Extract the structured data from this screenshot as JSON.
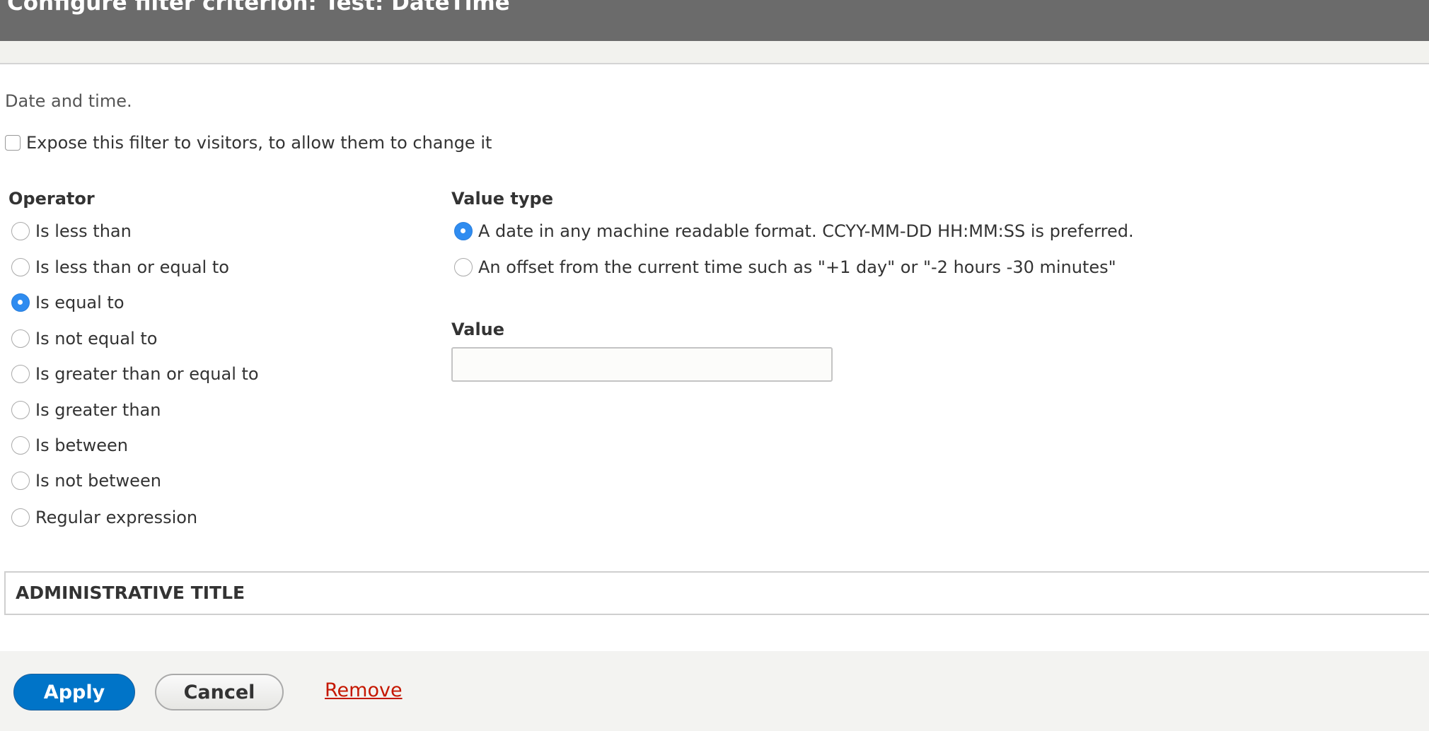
{
  "dialog": {
    "title": "Configure filter criterion: Test: DateTime"
  },
  "description": "Date and time.",
  "expose": {
    "label": "Expose this filter to visitors, to allow them to change it",
    "checked": false
  },
  "operator": {
    "heading": "Operator",
    "options": [
      "Is less than",
      "Is less than or equal to",
      "Is equal to",
      "Is not equal to",
      "Is greater than or equal to",
      "Is greater than",
      "Is between",
      "Is not between",
      "Regular expression"
    ],
    "selected": "Is equal to"
  },
  "value_type": {
    "heading": "Value type",
    "options": [
      "A date in any machine readable format. CCYY-MM-DD HH:MM:SS is preferred.",
      "An offset from the current time such as \"+1 day\" or \"-2 hours -30 minutes\""
    ],
    "selected": 0
  },
  "value": {
    "label": "Value",
    "value": ""
  },
  "admin": {
    "title": "ADMINISTRATIVE TITLE"
  },
  "buttons": {
    "apply": "Apply",
    "cancel": "Cancel",
    "remove": "Remove"
  },
  "colors": {
    "header": "#6b6b6b",
    "primary": "#0074c8",
    "radio_selected": "#2f8cf0",
    "remove_link": "#c51700"
  }
}
